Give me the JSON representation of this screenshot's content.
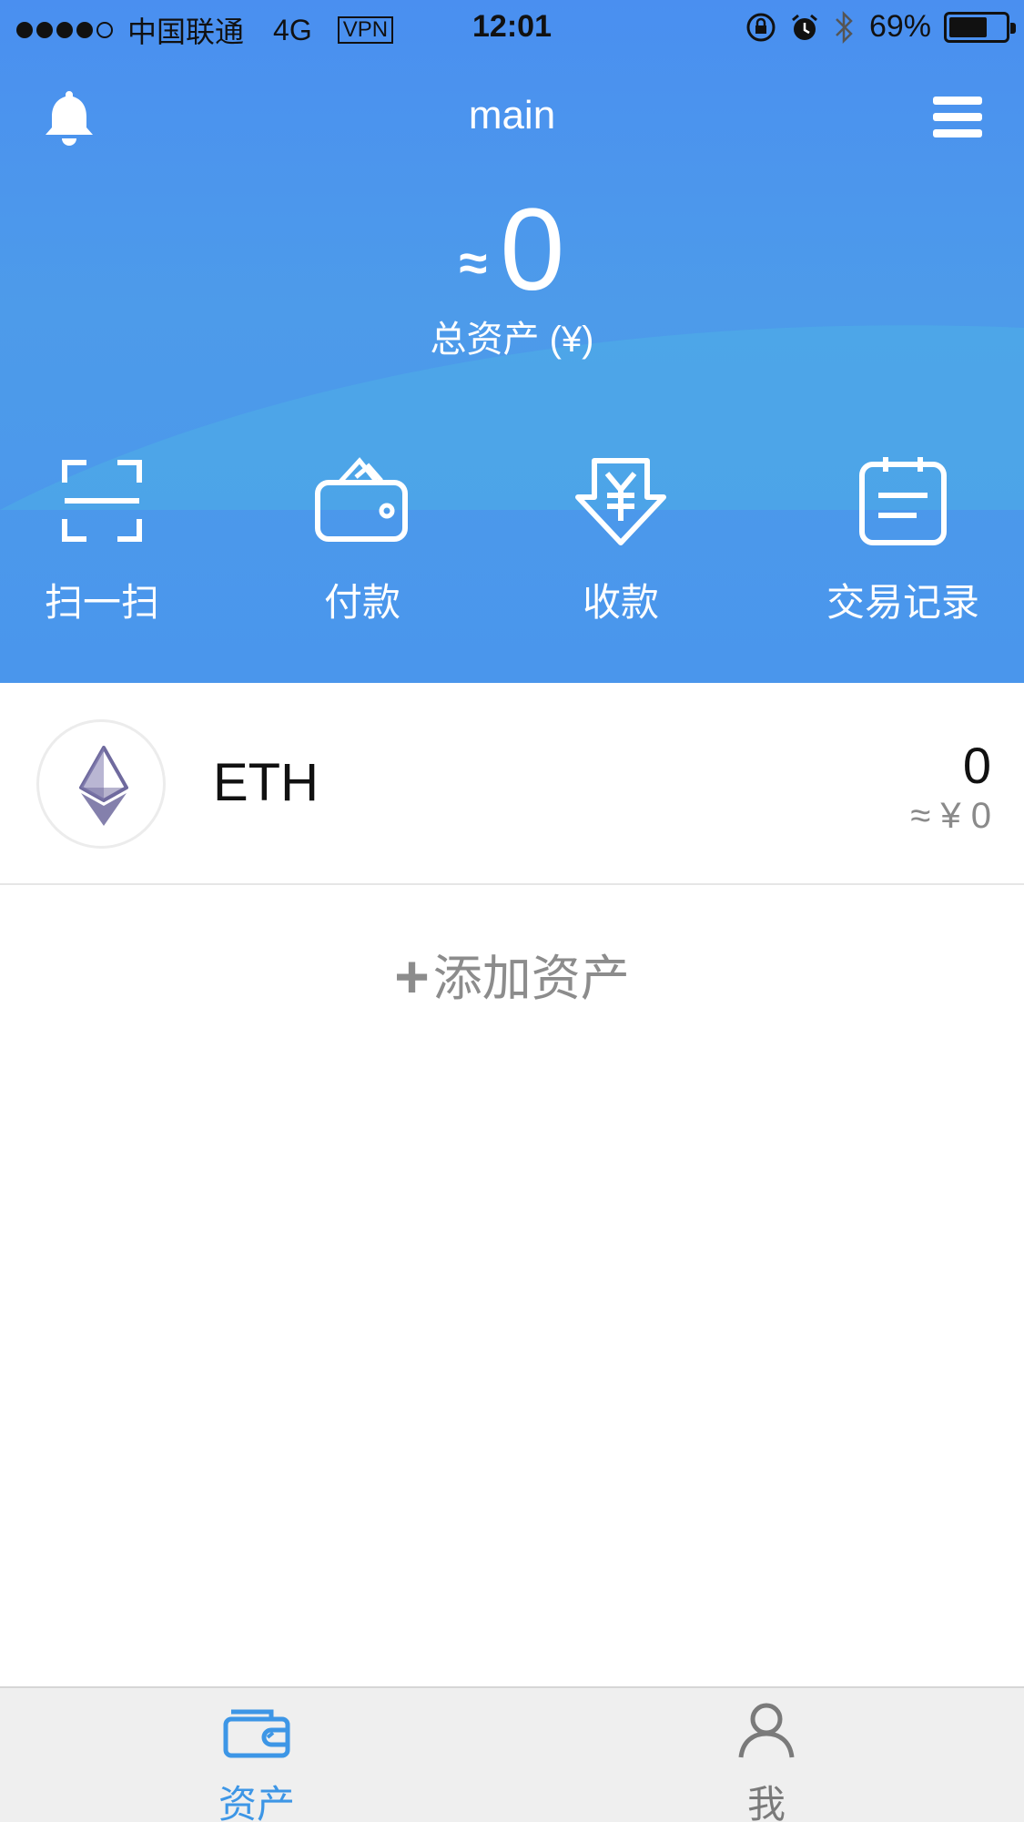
{
  "status_bar": {
    "carrier": "中国联通",
    "network": "4G",
    "vpn": "VPN",
    "time": "12:01",
    "battery_percent": "69%",
    "battery_level": 0.69
  },
  "nav": {
    "title": "main",
    "left_icon": "bell-icon",
    "right_icon": "menu-icon"
  },
  "balance": {
    "approx": "≈",
    "value": "0",
    "label": "总资产 (¥)"
  },
  "actions": [
    {
      "label": "扫一扫",
      "icon": "scan-icon"
    },
    {
      "label": "付款",
      "icon": "wallet-icon"
    },
    {
      "label": "收款",
      "icon": "receive-icon"
    },
    {
      "label": "交易记录",
      "icon": "records-icon"
    }
  ],
  "assets": [
    {
      "symbol": "ETH",
      "amount": "0",
      "fiat": "≈ ¥ 0",
      "icon": "ethereum-icon"
    }
  ],
  "add_asset": {
    "plus": "+",
    "label": "添加资产"
  },
  "tabs": [
    {
      "label": "资产",
      "icon": "wallet-tab-icon",
      "active": true
    },
    {
      "label": "我",
      "icon": "person-icon",
      "active": false
    }
  ],
  "colors": {
    "header_blue": "#4a8ff0",
    "tab_active": "#3d96e6",
    "tab_inactive": "#7a7a7a",
    "eth_purple": "#6f6a9e"
  }
}
